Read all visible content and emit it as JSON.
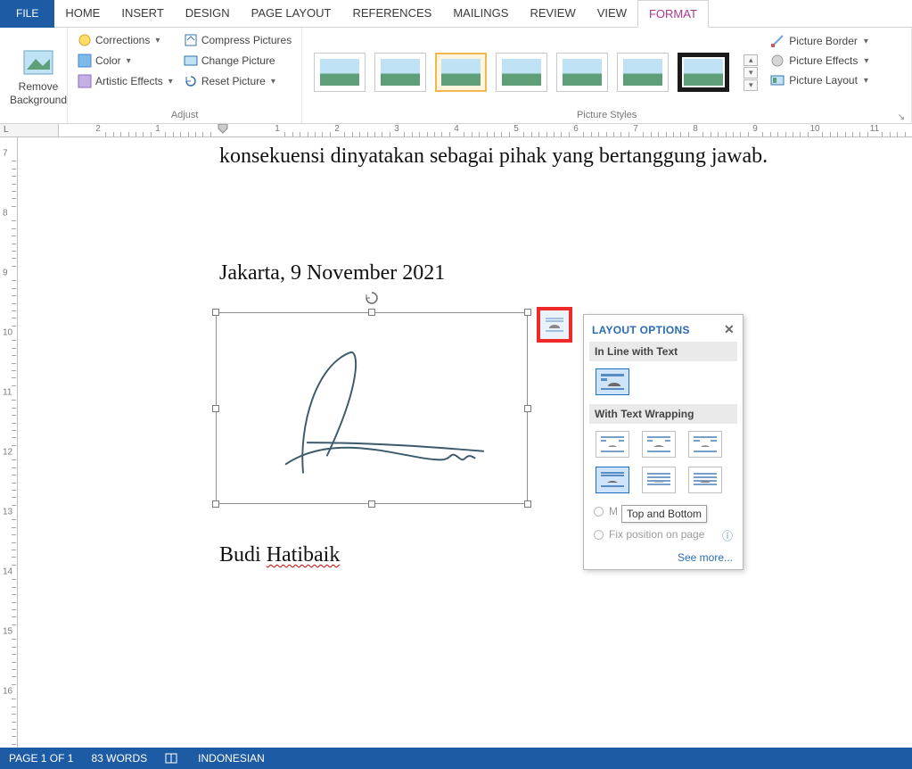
{
  "tabs": {
    "file": "FILE",
    "home": "HOME",
    "insert": "INSERT",
    "design": "DESIGN",
    "pagelayout": "PAGE LAYOUT",
    "references": "REFERENCES",
    "mailings": "MAILINGS",
    "review": "REVIEW",
    "view": "VIEW",
    "format": "FORMAT"
  },
  "ribbon": {
    "remove_bg": "Remove\nBackground",
    "adjust": {
      "corrections": "Corrections",
      "color": "Color",
      "artistic": "Artistic Effects",
      "compress": "Compress Pictures",
      "change": "Change Picture",
      "reset": "Reset Picture",
      "label": "Adjust"
    },
    "styles": {
      "label": "Picture Styles"
    },
    "picture": {
      "border": "Picture Border",
      "effects": "Picture Effects",
      "layout": "Picture Layout"
    }
  },
  "document": {
    "line1": "konsekuensi dinyatakan sebagai pihak yang bertanggung jawab.",
    "date": "Jakarta, 9 November 2021",
    "name_first": "Budi ",
    "name_last": "Hatibaik"
  },
  "layout_popup": {
    "title": "LAYOUT OPTIONS",
    "inline": "In Line with Text",
    "wrap": "With Text Wrapping",
    "move": "M",
    "tooltip": "Top and Bottom",
    "fix": "Fix position on page",
    "seemore": "See more..."
  },
  "ruler": {
    "h": [
      "2",
      "1",
      "1",
      "2",
      "3",
      "4",
      "5",
      "6",
      "7",
      "8",
      "9",
      "10",
      "11"
    ],
    "v": [
      "7",
      "8",
      "9",
      "10",
      "11",
      "12",
      "13",
      "14",
      "15",
      "16"
    ]
  },
  "status": {
    "page": "PAGE 1 OF 1",
    "words": "83 WORDS",
    "lang": "INDONESIAN"
  },
  "ruler_corner": "L"
}
